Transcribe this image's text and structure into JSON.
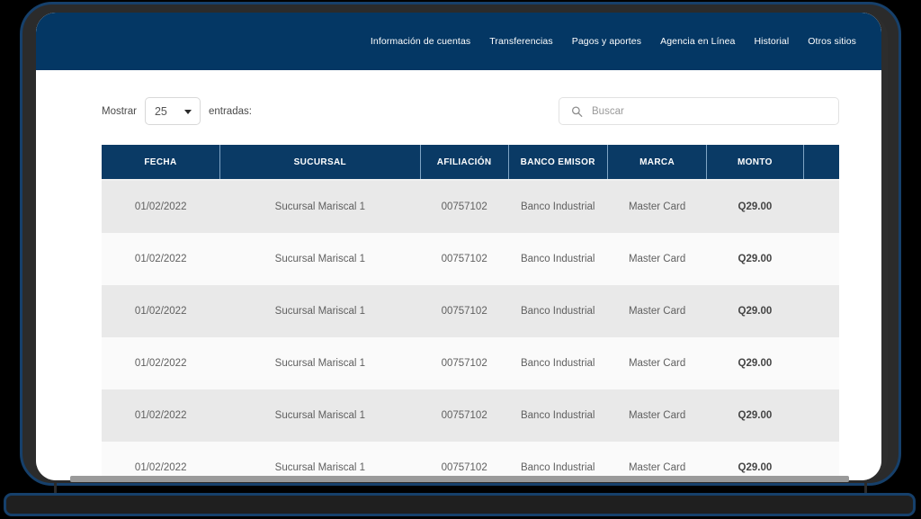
{
  "topnav": {
    "items": [
      {
        "label": "Información de cuentas"
      },
      {
        "label": "Transferencias"
      },
      {
        "label": "Pagos y aportes"
      },
      {
        "label": "Agencia en Línea"
      },
      {
        "label": "Historial"
      },
      {
        "label": "Otros sitios"
      }
    ],
    "background_color": "#043764",
    "text_color": "#ffffff"
  },
  "controls": {
    "length_label_before": "Mostrar",
    "length_value": "25",
    "length_label_after": "entradas:",
    "search_placeholder": "Buscar",
    "search_value": "",
    "search_icon": "search-icon",
    "caret_icon": "chevron-down-icon"
  },
  "table": {
    "header_background": "#0a3a65",
    "row_odd_background": "#e9e9e9",
    "row_even_background": "#fafafa",
    "columns": [
      {
        "key": "fecha",
        "label": "FECHA"
      },
      {
        "key": "sucursal",
        "label": "SUCURSAL"
      },
      {
        "key": "afiliacion",
        "label": "AFILIACIÓN"
      },
      {
        "key": "banco",
        "label": "BANCO EMISOR"
      },
      {
        "key": "marca",
        "label": "MARCA"
      },
      {
        "key": "monto",
        "label": "MONTO"
      },
      {
        "key": "extra",
        "label": ""
      }
    ],
    "rows": [
      {
        "fecha": "01/02/2022",
        "sucursal": "Sucursal Mariscal 1",
        "afiliacion": "00757102",
        "banco": "Banco Industrial",
        "marca": "Master Card",
        "monto": "Q29.00",
        "extra": ""
      },
      {
        "fecha": "01/02/2022",
        "sucursal": "Sucursal Mariscal 1",
        "afiliacion": "00757102",
        "banco": "Banco Industrial",
        "marca": "Master Card",
        "monto": "Q29.00",
        "extra": ""
      },
      {
        "fecha": "01/02/2022",
        "sucursal": "Sucursal Mariscal 1",
        "afiliacion": "00757102",
        "banco": "Banco Industrial",
        "marca": "Master Card",
        "monto": "Q29.00",
        "extra": ""
      },
      {
        "fecha": "01/02/2022",
        "sucursal": "Sucursal Mariscal 1",
        "afiliacion": "00757102",
        "banco": "Banco Industrial",
        "marca": "Master Card",
        "monto": "Q29.00",
        "extra": ""
      },
      {
        "fecha": "01/02/2022",
        "sucursal": "Sucursal Mariscal 1",
        "afiliacion": "00757102",
        "banco": "Banco Industrial",
        "marca": "Master Card",
        "monto": "Q29.00",
        "extra": ""
      },
      {
        "fecha": "01/02/2022",
        "sucursal": "Sucursal Mariscal 1",
        "afiliacion": "00757102",
        "banco": "Banco Industrial",
        "marca": "Master Card",
        "monto": "Q29.00",
        "extra": ""
      }
    ]
  }
}
